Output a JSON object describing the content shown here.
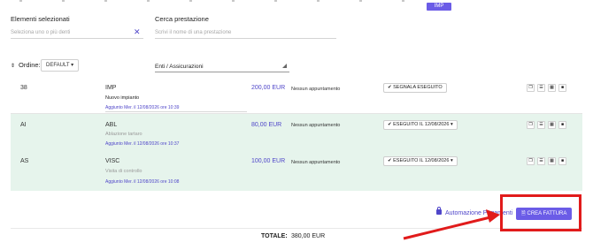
{
  "header": {
    "badge": "IMP"
  },
  "filters": {
    "selected_label": "Elementi selezionati",
    "selected_placeholder": "Seleziona uno o più denti",
    "search_label": "Cerca prestazione",
    "search_placeholder": "Scrivi il nome di una prestazione",
    "clear_icon": "close-icon"
  },
  "order": {
    "label": "Ordine:",
    "value": "DEFAULT ▾",
    "sort_icon": "⇕",
    "enti_label": "Enti / Assicurazioni"
  },
  "rows": [
    {
      "code": "38",
      "name": "IMP",
      "description": "Nuovo impianto",
      "added": "Aggiunto Mer. il 12/08/2026 ore 10:39",
      "price": "200,00 EUR",
      "appointment": "Nessun appuntamento",
      "status": "✔ SEGNALA ESEGUITO"
    },
    {
      "code": "AI",
      "name": "ABL",
      "description": "Ablazione tartaro",
      "added": "Aggiunto Mer. il 12/08/2026 ore 10:37",
      "price": "80,00 EUR",
      "appointment": "Nessun appuntamento",
      "status": "✔ ESEGUITO IL 12/08/2026 ▾"
    },
    {
      "code": "AS",
      "name": "VISC",
      "description": "Visita di controllo",
      "added": "Aggiunto Mer. il 12/08/2026 ore 10:08",
      "price": "100,00 EUR",
      "appointment": "Nessun appuntamento",
      "status": "✔ ESEGUITO IL 12/08/2026 ▾"
    }
  ],
  "footer": {
    "automazione": "Automazione Pagamenti",
    "crea_fattura": "CREA FATTURA",
    "totale_label": "TOTALE:",
    "totale_value": "380,00 EUR"
  },
  "colors": {
    "accent": "#6b5ce7",
    "link": "#4f46c9",
    "row_highlight": "#e6f4ec",
    "annotation": "#e11b1b"
  }
}
